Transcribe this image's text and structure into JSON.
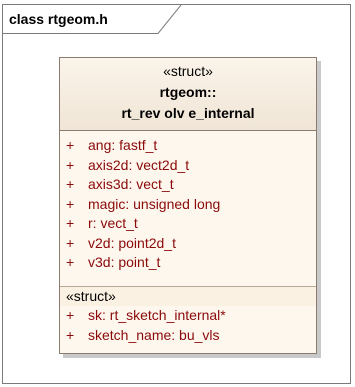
{
  "diagram": {
    "frame_label": "class rtgeom.h",
    "class": {
      "stereotype": "«struct»",
      "name_line1": "rtgeom::",
      "name_line2": "rt_rev olv e_internal",
      "attributes": [
        {
          "visibility": "+",
          "text": "ang:  fastf_t"
        },
        {
          "visibility": "+",
          "text": "axis2d:  vect2d_t"
        },
        {
          "visibility": "+",
          "text": "axis3d:  vect_t"
        },
        {
          "visibility": "+",
          "text": "magic:  unsigned long"
        },
        {
          "visibility": "+",
          "text": "r:  vect_t"
        },
        {
          "visibility": "+",
          "text": "v2d:  point2d_t"
        },
        {
          "visibility": "+",
          "text": "v3d:  point_t"
        }
      ],
      "section_stereotype": "«struct»",
      "struct_attributes": [
        {
          "visibility": "+",
          "text": "sk:  rt_sketch_internal*"
        },
        {
          "visibility": "+",
          "text": "sketch_name:  bu_vls"
        }
      ]
    }
  },
  "colors": {
    "attribute_text": "#8b0a0a",
    "class_fill": "#fdf7ee",
    "border": "#8a7c6e"
  }
}
